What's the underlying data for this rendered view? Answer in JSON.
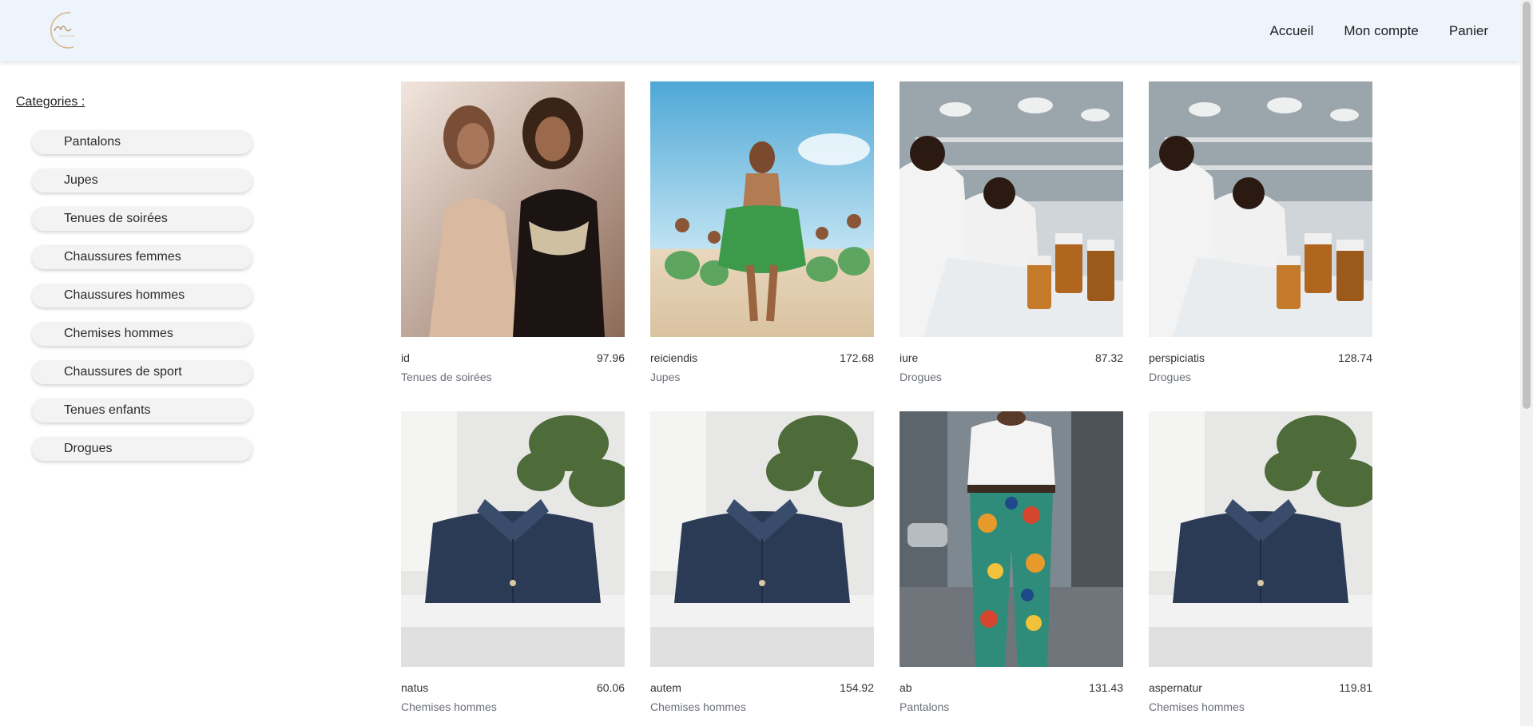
{
  "header": {
    "nav": [
      "Accueil",
      "Mon compte",
      "Panier"
    ]
  },
  "sidebar": {
    "title": "Categories :",
    "items": [
      "Pantalons",
      "Jupes",
      "Tenues de soirées",
      "Chaussures femmes",
      "Chaussures hommes",
      "Chemises hommes",
      "Chaussures de sport",
      "Tenues enfants",
      "Drogues"
    ]
  },
  "products": [
    {
      "name": "id",
      "price": "97.96",
      "category": "Tenues de soirées",
      "image": "evening-dress-photo"
    },
    {
      "name": "reiciendis",
      "price": "172.68",
      "category": "Jupes",
      "image": "beach-dancer-photo"
    },
    {
      "name": "iure",
      "price": "87.32",
      "category": "Drogues",
      "image": "pharmacy-lab-photo"
    },
    {
      "name": "perspiciatis",
      "price": "128.74",
      "category": "Drogues",
      "image": "pharmacy-lab-photo"
    },
    {
      "name": "natus",
      "price": "60.06",
      "category": "Chemises hommes",
      "image": "folded-shirt-photo"
    },
    {
      "name": "autem",
      "price": "154.92",
      "category": "Chemises hommes",
      "image": "folded-shirt-photo"
    },
    {
      "name": "ab",
      "price": "131.43",
      "category": "Pantalons",
      "image": "floral-pants-photo"
    },
    {
      "name": "aspernatur",
      "price": "119.81",
      "category": "Chemises hommes",
      "image": "folded-shirt-photo"
    }
  ],
  "colors": {
    "header_bg": "#eef4fc",
    "category_pill_bg": "#f3f3f4",
    "muted_text": "#6b6f78"
  }
}
